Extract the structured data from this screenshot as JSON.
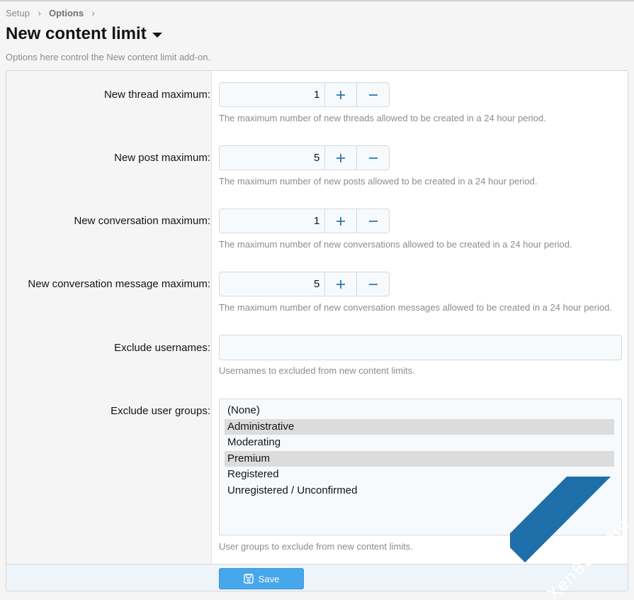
{
  "breadcrumb": {
    "items": [
      "Setup",
      "Options"
    ]
  },
  "page": {
    "title": "New content limit",
    "description": "Options here control the New content limit add-on."
  },
  "options": [
    {
      "label": "New thread maximum:",
      "value": "1",
      "hint": "The maximum number of new threads allowed to be created in a 24 hour period."
    },
    {
      "label": "New post maximum:",
      "value": "5",
      "hint": "The maximum number of new posts allowed to be created in a 24 hour period."
    },
    {
      "label": "New conversation maximum:",
      "value": "1",
      "hint": "The maximum number of new conversations allowed to be created in a 24 hour period."
    },
    {
      "label": "New conversation message maximum:",
      "value": "5",
      "hint": "The maximum number of new conversation messages allowed to be created in a 24 hour period."
    }
  ],
  "exclude_usernames": {
    "label": "Exclude usernames:",
    "value": "",
    "hint": "Usernames to excluded from new content limits."
  },
  "exclude_user_groups": {
    "label": "Exclude user groups:",
    "options": [
      {
        "label": "(None)",
        "selected": false
      },
      {
        "label": "Administrative",
        "selected": true
      },
      {
        "label": "Moderating",
        "selected": false
      },
      {
        "label": "Premium",
        "selected": true
      },
      {
        "label": "Registered",
        "selected": false
      },
      {
        "label": "Unregistered / Unconfirmed",
        "selected": false
      }
    ],
    "hint": "User groups to exclude from new content limits."
  },
  "footer": {
    "save_label": "Save"
  },
  "watermark": {
    "text": "XenBD.Com"
  },
  "colors": {
    "accent": "#47a7eb",
    "link": "#2577b1",
    "selected_bg": "#dcdcdc",
    "watermark": "#1d6ea9"
  }
}
